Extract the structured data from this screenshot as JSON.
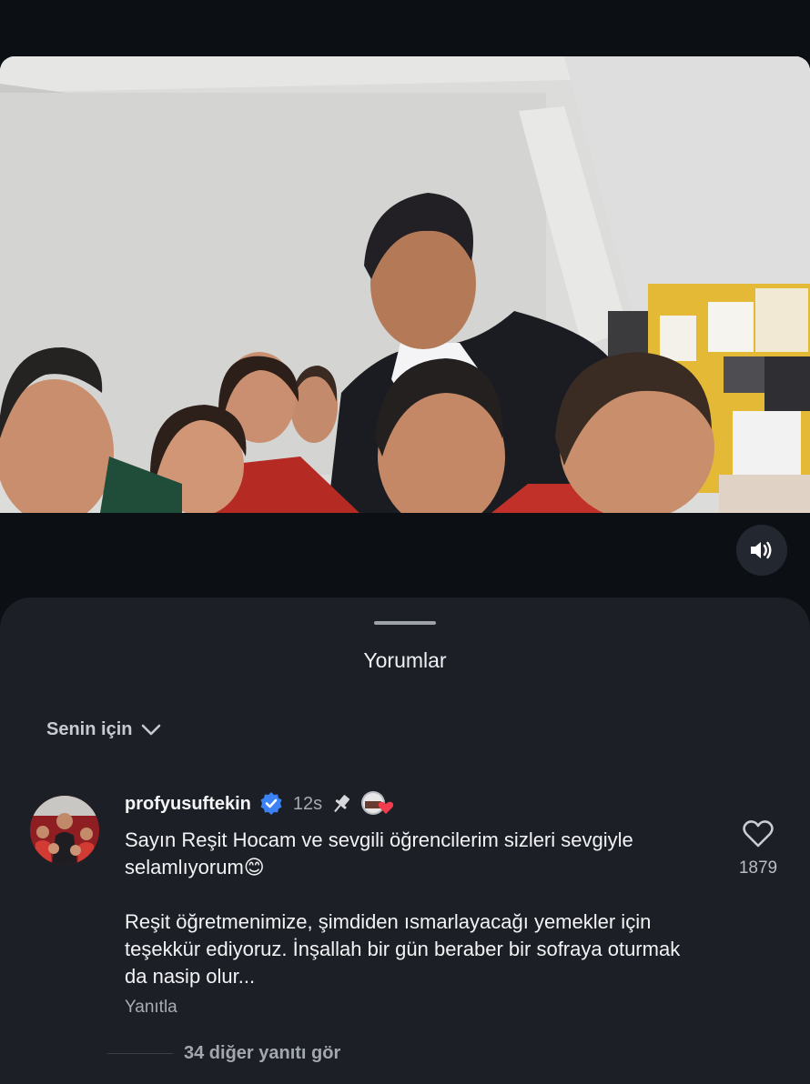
{
  "video": {
    "sound_icon": "speaker-volume-icon"
  },
  "comments_sheet": {
    "title": "Yorumlar",
    "sort_label": "Senin için",
    "sort_icon": "chevron-down-icon"
  },
  "comment": {
    "username": "profyusuftekin",
    "verified_icon": "verified-badge-icon",
    "time": "12s",
    "pinned_icon": "pin-icon",
    "creator_liked_icon": "creator-heart-avatar-icon",
    "text_paragraphs": [
      "Sayın Reşit Hocam ve sevgili öğrencilerim sizleri sevgiyle selamlıyorum😊",
      "Reşit öğretmenimize, şimdiden ısmarlayacağı yemekler için teşekkür ediyoruz. İnşallah bir gün beraber bir sofraya oturmak da nasip olur..."
    ],
    "reply_label": "Yanıtla",
    "like_count": "1879",
    "like_icon": "heart-outline-icon"
  },
  "more_replies_label": "34 diğer yanıtı gör",
  "colors": {
    "background": "#0c1015",
    "sheet": "#1c1f26",
    "verified": "#3b82f6"
  }
}
